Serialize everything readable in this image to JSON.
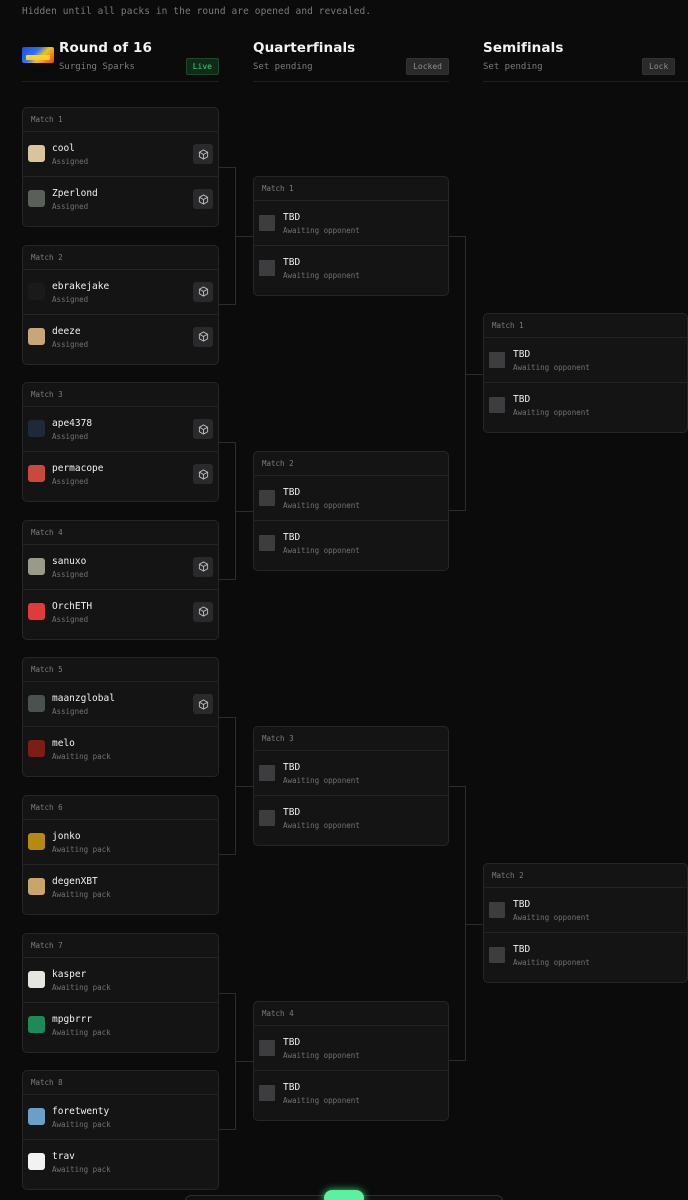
{
  "notice": "Hidden until all packs in the round are opened and revealed.",
  "columns": [
    {
      "title": "Round of 16",
      "subtitle": "Surging Sparks",
      "badge": "Live"
    },
    {
      "title": "Quarterfinals",
      "subtitle": "Set pending",
      "badge": "Locked"
    },
    {
      "title": "Semifinals",
      "subtitle": "Set pending",
      "badge": "Lock"
    }
  ],
  "round16": [
    {
      "label": "Match 1",
      "players": [
        {
          "name": "cool",
          "status": "Assigned",
          "avatar": "cool-avatar",
          "color": "#d9c59a"
        },
        {
          "name": "Zperlond",
          "status": "Assigned",
          "avatar": "zperlond-avatar",
          "color": "#5a5f5a"
        }
      ]
    },
    {
      "label": "Match 2",
      "players": [
        {
          "name": "ebrakejake",
          "status": "Assigned",
          "avatar": "ebrakejake-avatar",
          "color": "#1a1a1a"
        },
        {
          "name": "deeze",
          "status": "Assigned",
          "avatar": "deeze-avatar",
          "color": "#c9a57a"
        }
      ]
    },
    {
      "label": "Match 3",
      "players": [
        {
          "name": "ape4378",
          "status": "Assigned",
          "avatar": "ape4378-avatar",
          "color": "#1e2a3a"
        },
        {
          "name": "permacope",
          "status": "Assigned",
          "avatar": "permacope-avatar",
          "color": "#c94a3a"
        }
      ]
    },
    {
      "label": "Match 4",
      "players": [
        {
          "name": "sanuxo",
          "status": "Assigned",
          "avatar": "sanuxo-avatar",
          "color": "#9a9a8a"
        },
        {
          "name": "OrchETH",
          "status": "Assigned",
          "avatar": "orcheth-avatar",
          "color": "#e23a3a"
        }
      ]
    },
    {
      "label": "Match 5",
      "players": [
        {
          "name": "maanzglobal",
          "status": "Assigned",
          "avatar": "maanzglobal-avatar",
          "color": "#4a524e"
        },
        {
          "name": "melo",
          "status": "Awaiting pack",
          "avatar": "melo-avatar",
          "color": "#7a1e16"
        }
      ]
    },
    {
      "label": "Match 6",
      "players": [
        {
          "name": "jonko",
          "status": "Awaiting pack",
          "avatar": "jonko-avatar",
          "color": "#b58a12"
        },
        {
          "name": "degenXBT",
          "status": "Awaiting pack",
          "avatar": "degenxbt-avatar",
          "color": "#c8a66a"
        }
      ]
    },
    {
      "label": "Match 7",
      "players": [
        {
          "name": "kasper",
          "status": "Awaiting pack",
          "avatar": "kasper-avatar",
          "color": "#e6e6e0"
        },
        {
          "name": "mpgbrrr",
          "status": "Awaiting pack",
          "avatar": "mpgbrrr-avatar",
          "color": "#1e8a5a"
        }
      ]
    },
    {
      "label": "Match 8",
      "players": [
        {
          "name": "foretwenty",
          "status": "Awaiting pack",
          "avatar": "foretwenty-avatar",
          "color": "#6aa0c8"
        },
        {
          "name": "trav",
          "status": "Awaiting pack",
          "avatar": "trav-avatar",
          "color": "#f2f2f2"
        }
      ]
    }
  ],
  "quarterfinals": [
    {
      "label": "Match 1",
      "players": [
        {
          "name": "TBD",
          "status": "Awaiting opponent"
        },
        {
          "name": "TBD",
          "status": "Awaiting opponent"
        }
      ]
    },
    {
      "label": "Match 2",
      "players": [
        {
          "name": "TBD",
          "status": "Awaiting opponent"
        },
        {
          "name": "TBD",
          "status": "Awaiting opponent"
        }
      ]
    },
    {
      "label": "Match 3",
      "players": [
        {
          "name": "TBD",
          "status": "Awaiting opponent"
        },
        {
          "name": "TBD",
          "status": "Awaiting opponent"
        }
      ]
    },
    {
      "label": "Match 4",
      "players": [
        {
          "name": "TBD",
          "status": "Awaiting opponent"
        },
        {
          "name": "TBD",
          "status": "Awaiting opponent"
        }
      ]
    }
  ],
  "semifinals": [
    {
      "label": "Match 1",
      "players": [
        {
          "name": "TBD",
          "status": "Awaiting opponent"
        },
        {
          "name": "TBD",
          "status": "Awaiting opponent"
        }
      ]
    },
    {
      "label": "Match 2",
      "players": [
        {
          "name": "TBD",
          "status": "Awaiting opponent"
        },
        {
          "name": "TBD",
          "status": "Awaiting opponent"
        }
      ]
    }
  ],
  "icons": {
    "pack": "cube-icon",
    "logo": "surging-sparks-logo"
  }
}
